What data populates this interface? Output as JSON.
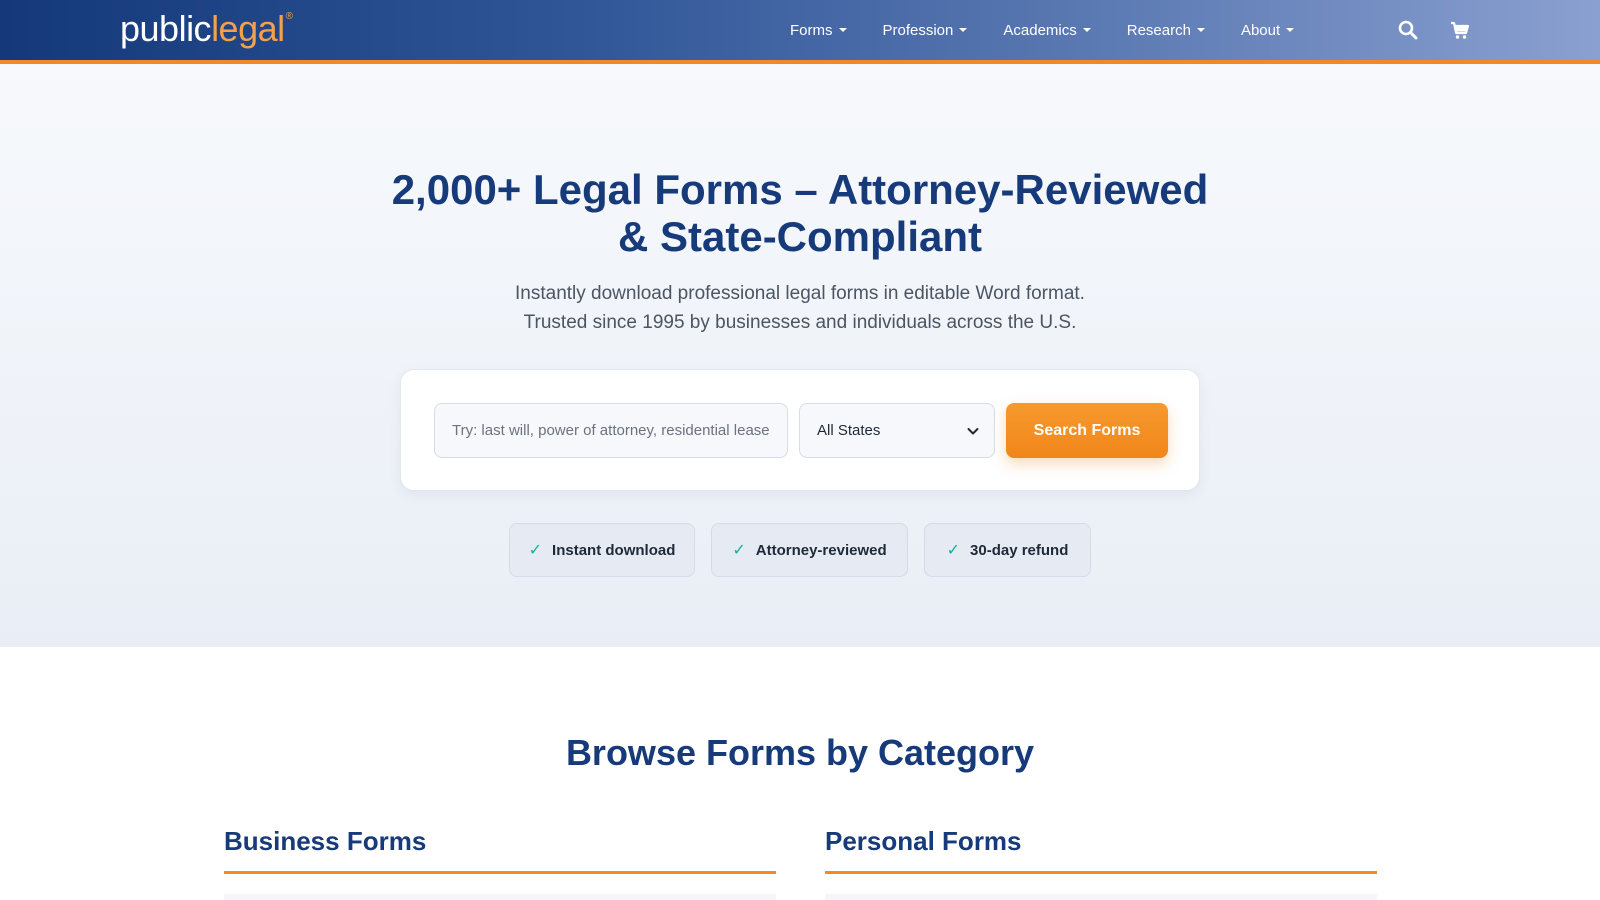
{
  "header": {
    "logo": {
      "part1": "public",
      "part2": "legal",
      "mark": "®"
    },
    "nav": [
      {
        "label": "Forms"
      },
      {
        "label": "Profession"
      },
      {
        "label": "Academics"
      },
      {
        "label": "Research"
      },
      {
        "label": "About"
      }
    ],
    "icons": {
      "search": "search-icon",
      "cart": "cart-icon"
    }
  },
  "hero": {
    "title_line1": "2,000+ Legal Forms – Attorney-Reviewed",
    "title_line2": "& State-Compliant",
    "subtitle_line1": "Instantly download professional legal forms in editable Word format.",
    "subtitle_line2": "Trusted since 1995 by businesses and individuals across the U.S.",
    "search": {
      "placeholder": "Try: last will, power of attorney, residential lease",
      "state_value": "All States",
      "button_label": "Search Forms"
    },
    "badges": [
      {
        "label": "Instant download"
      },
      {
        "label": "Attorney-reviewed"
      },
      {
        "label": "30-day refund"
      }
    ]
  },
  "browse": {
    "title": "Browse Forms by Category",
    "categories": [
      {
        "label": "Business Forms"
      },
      {
        "label": "Personal Forms"
      }
    ]
  },
  "colors": {
    "brand_navy": "#163a7a",
    "accent_orange": "#f08a24",
    "check_green": "#10b39a"
  }
}
